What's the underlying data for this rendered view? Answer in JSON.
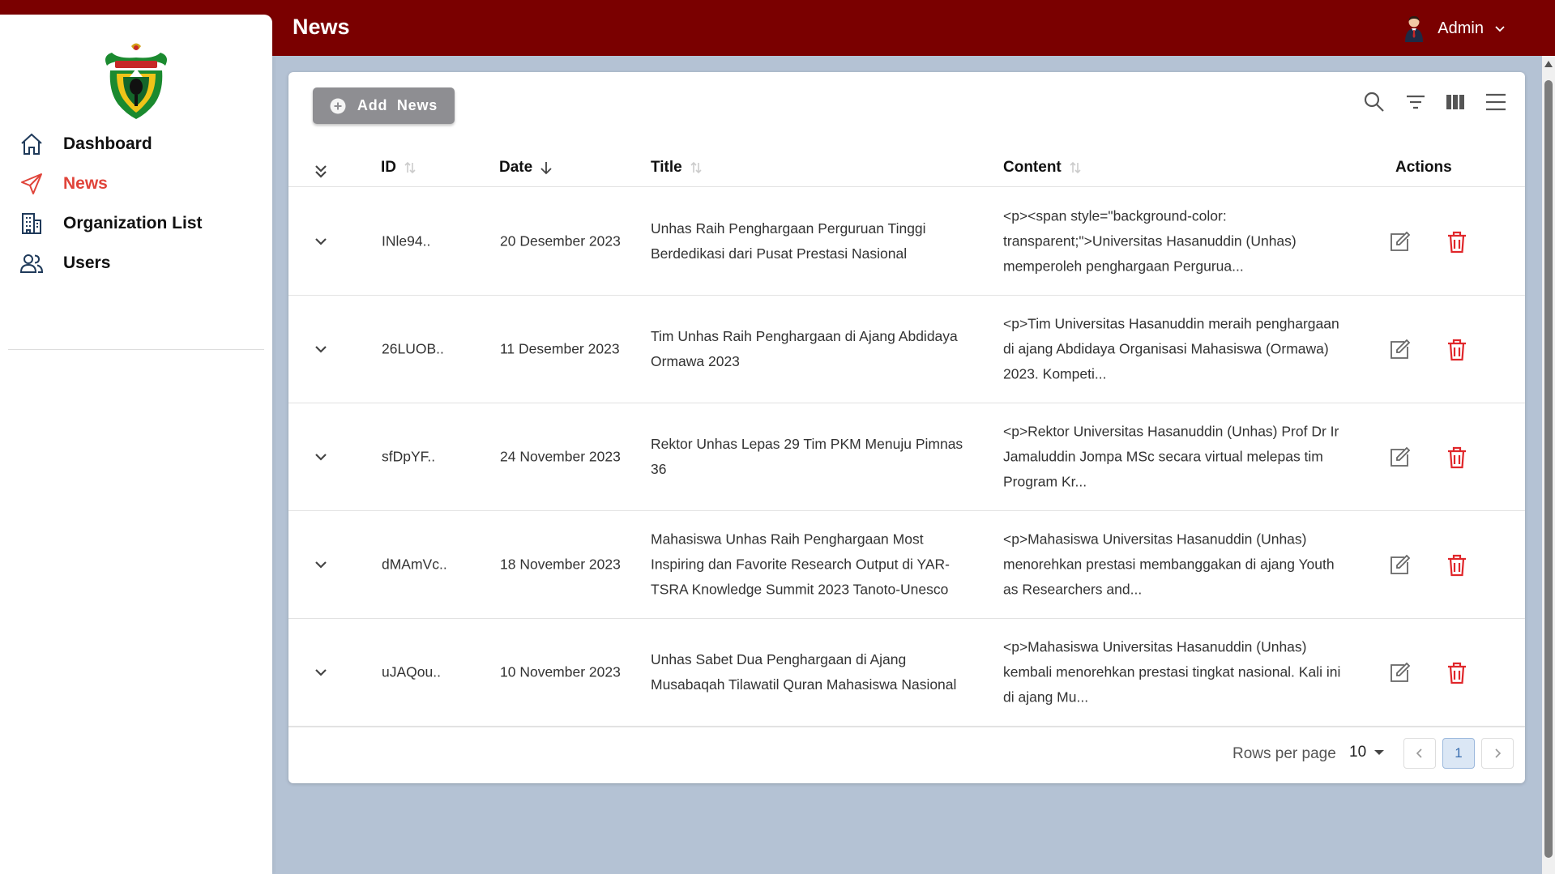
{
  "header": {
    "title": "News",
    "user_name": "Admin"
  },
  "sidebar": {
    "items": [
      {
        "label": "Dashboard",
        "icon": "home-icon",
        "active": false
      },
      {
        "label": "News",
        "icon": "send-icon",
        "active": true
      },
      {
        "label": "Organization List",
        "icon": "building-icon",
        "active": false
      },
      {
        "label": "Users",
        "icon": "users-icon",
        "active": false
      }
    ]
  },
  "toolbar": {
    "add_label": "Add  News",
    "icons": [
      "search-icon",
      "filter-icon",
      "columns-icon",
      "density-icon"
    ]
  },
  "table": {
    "columns": {
      "id": "ID",
      "date": "Date",
      "title": "Title",
      "content": "Content",
      "actions": "Actions"
    },
    "rows": [
      {
        "id": "INle94..",
        "date": "20 Desember 2023",
        "title": "Unhas Raih Penghargaan Perguruan Tinggi Berdedikasi dari Pusat Prestasi Nasional",
        "content": "<p><span style=\"background-color: transparent;\">Universitas Hasanuddin (Unhas) memperoleh penghargaan Pergurua..."
      },
      {
        "id": "26LUOB..",
        "date": "11 Desember 2023",
        "title": "Tim Unhas Raih Penghargaan di Ajang Abdidaya Ormawa 2023",
        "content": "<p>Tim Universitas Hasanuddin meraih penghargaan di ajang Abdidaya Organisasi Mahasiswa (Ormawa) 2023. Kompeti..."
      },
      {
        "id": "sfDpYF..",
        "date": "24 November 2023",
        "title": "Rektor Unhas Lepas 29 Tim PKM Menuju Pimnas 36",
        "content": "<p>Rektor Universitas Hasanuddin (Unhas) Prof Dr Ir Jamaluddin Jompa MSc secara virtual melepas tim Program Kr..."
      },
      {
        "id": "dMAmVc..",
        "date": "18 November 2023",
        "title": "Mahasiswa Unhas Raih Penghargaan Most Inspiring dan Favorite Research Output di YAR-TSRA Knowledge Summit 2023 Tanoto-Unesco",
        "content": "<p>Mahasiswa Universitas Hasanuddin (Unhas) menorehkan prestasi membanggakan di ajang Youth as Researchers and..."
      },
      {
        "id": "uJAQou..",
        "date": "10 November 2023",
        "title": "Unhas Sabet Dua Penghargaan di Ajang Musabaqah Tilawatil Quran Mahasiswa Nasional",
        "content": "<p>Mahasiswa Universitas Hasanuddin (Unhas) kembali menorehkan prestasi tingkat nasional. Kali ini di ajang Mu..."
      }
    ]
  },
  "pagination": {
    "rows_per_page_label": "Rows per page",
    "rows_per_page": "10",
    "current_page": "1"
  },
  "colors": {
    "header_bg": "#7a0000",
    "active_nav": "#e0443a",
    "delete": "#e0262a",
    "add_button": "#8e8e92"
  }
}
